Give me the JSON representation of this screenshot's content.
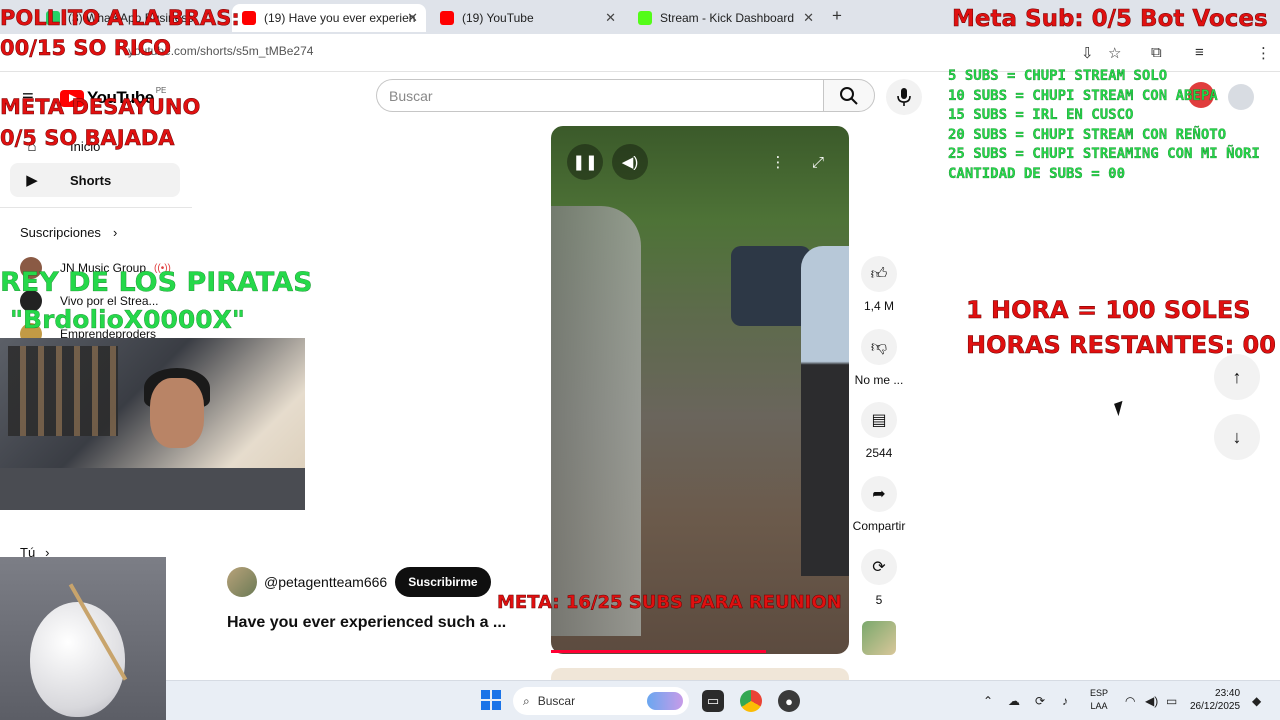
{
  "browser": {
    "tabs": [
      {
        "title": "(3) WhatsApp Business",
        "active": false
      },
      {
        "title": "(19) Have you ever experien",
        "active": true
      },
      {
        "title": "(19) YouTube",
        "active": false
      },
      {
        "title": "Stream - Kick Dashboard",
        "active": false
      }
    ],
    "new_tab": "+",
    "url": "youtube.com/shorts/s5m_tMBe274",
    "close": "✕"
  },
  "youtube": {
    "logo_text": "YouTube",
    "country": "PE",
    "search_placeholder": "Buscar",
    "sidebar": {
      "items": [
        {
          "label": "Inicio",
          "icon": "home-icon"
        },
        {
          "label": "Shorts",
          "icon": "shorts-icon"
        }
      ],
      "subscriptions_header": "Suscripciones",
      "subscriptions": [
        {
          "label": "JN Music Group"
        },
        {
          "label": "Vivo por el Strea..."
        },
        {
          "label": "Emprendeproders"
        }
      ],
      "you_header": "Tú"
    },
    "short": {
      "channel": "@petagentteam666",
      "subscribe_label": "Suscribirme",
      "title": "Have you ever experienced such a ...",
      "like_count": "1,4 M",
      "dislike_label": "No me ...",
      "comments_count": "2544",
      "share_label": "Compartir",
      "remix_count": "5",
      "progress": 0.72
    }
  },
  "overlay": {
    "top_left": "POLLITO A LA BRAS:",
    "top_left_count": "00/15 SO RICO",
    "breakfast_goal_1": "META DESAYUNO",
    "breakfast_goal_2": "0/5 SO BAJADA",
    "top_right": "Meta Sub: 0/5 Bot Voces",
    "sub_tiers": [
      "5 SUBS = CHUPI STREAM SOLO",
      "10 SUBS = CHUPI STREAM CON ABEPA",
      "15 SUBS = IRL EN CUSCO",
      "20 SUBS = CHUPI STREAM CON REÑOTO",
      "25 SUBS = CHUPI STREAMING CON MI ÑORI",
      "CANTIDAD DE SUBS = 00"
    ],
    "pirates_1": "REY DE LOS PIRATAS",
    "pirates_2": "\"BrdolioX0000X\"",
    "hour_rate": "1 HORA = 100 SOLES",
    "hours_left": "HORAS RESTANTES: 00",
    "meeting_goal": "META: 16/25 SUBS PARA REUNION"
  },
  "taskbar": {
    "search_label": "Buscar",
    "lang_1": "ESP",
    "lang_2": "LAA",
    "time": "23:40",
    "date": "26/12/2025"
  }
}
